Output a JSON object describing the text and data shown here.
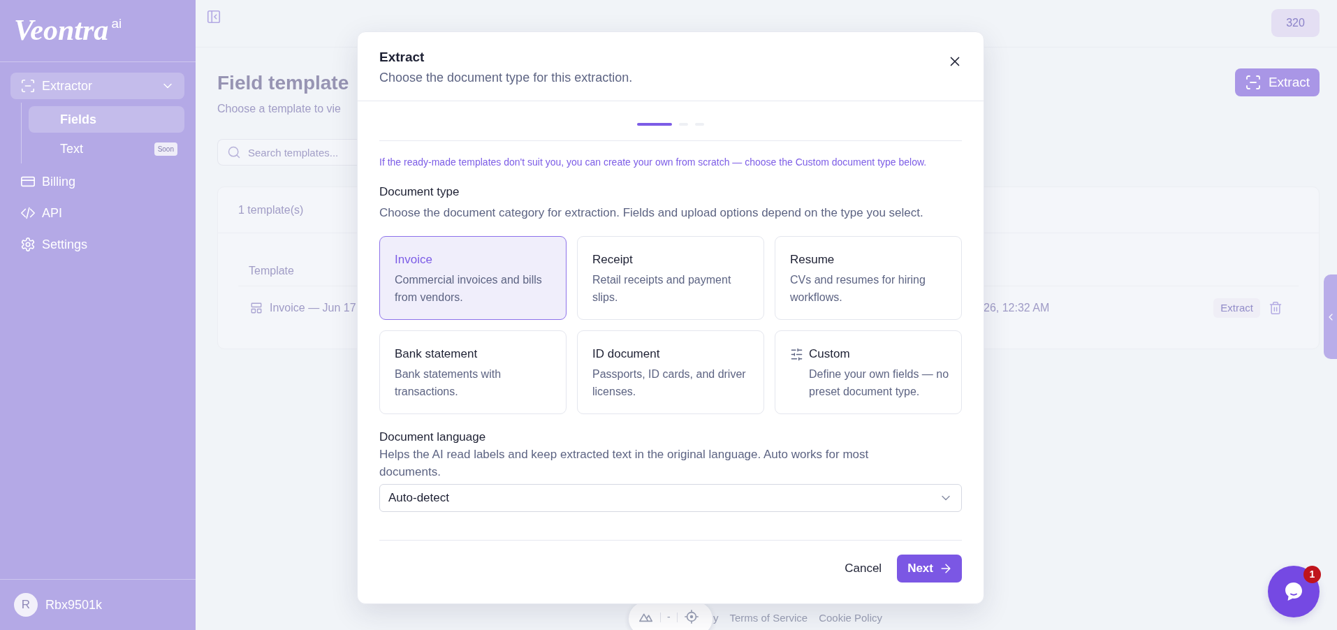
{
  "sidebar": {
    "logo": {
      "name": "Veontra",
      "suffix": "ai"
    },
    "items": [
      {
        "label": "Extractor",
        "selected": true,
        "expanded": true,
        "children": [
          {
            "label": "Fields",
            "selected": true
          },
          {
            "label": "Text",
            "selected": false,
            "badge": "Soon"
          }
        ]
      },
      {
        "label": "Billing",
        "selected": false
      },
      {
        "label": "API",
        "selected": false
      },
      {
        "label": "Settings",
        "selected": false
      }
    ],
    "user": {
      "initial": "R",
      "name": "Rbx9501k"
    }
  },
  "topbar": {
    "credits": "320"
  },
  "page": {
    "title": "Field template",
    "subtitle": "Choose a template to vie",
    "extract_button": "Extract",
    "search": {
      "placeholder": "Search templates..."
    },
    "templates_card": {
      "count": "1 template(s)",
      "columns": [
        "Template"
      ],
      "rows": [
        {
          "name": "Invoice — Jun 17",
          "date": "26, 12:32 AM",
          "action": "Extract"
        }
      ]
    }
  },
  "footer": {
    "links": [
      "y",
      "Terms of Service",
      "Cookie Policy"
    ]
  },
  "devtools": {
    "value": "-"
  },
  "chat": {
    "unread": "1"
  },
  "modal": {
    "title": "Extract",
    "subtitle": "Choose the document type for this extraction.",
    "steps": [
      {
        "current": true
      },
      {
        "current": false
      },
      {
        "current": false
      }
    ],
    "notice": "If the ready-made templates don't suit you, you can create your own from scratch — choose the Custom document type below.",
    "document_type": {
      "label": "Document type",
      "description": "Choose the document category for extraction. Fields and upload options depend on the type you select.",
      "options": [
        {
          "kind": "preset",
          "title": "Invoice",
          "description": "Commercial invoices and bills from vendors.",
          "selected": true
        },
        {
          "kind": "preset",
          "title": "Receipt",
          "description": "Retail receipts and payment slips.",
          "selected": false
        },
        {
          "kind": "preset",
          "title": "Resume",
          "description": "CVs and resumes for hiring workflows.",
          "selected": false
        },
        {
          "kind": "preset",
          "title": "Bank statement",
          "description": "Bank statements with transactions.",
          "selected": false
        },
        {
          "kind": "preset",
          "title": "ID document",
          "description": "Passports, ID cards, and driver licenses.",
          "selected": false
        },
        {
          "kind": "custom",
          "title": "Custom",
          "description": "Define your own fields — no preset document type.",
          "selected": false
        }
      ]
    },
    "document_language": {
      "label": "Document language",
      "description": "Helps the AI read labels and keep extracted text in the original language. Auto works for most documents.",
      "value": "Auto-detect"
    },
    "buttons": {
      "cancel": "Cancel",
      "next": "Next"
    }
  }
}
